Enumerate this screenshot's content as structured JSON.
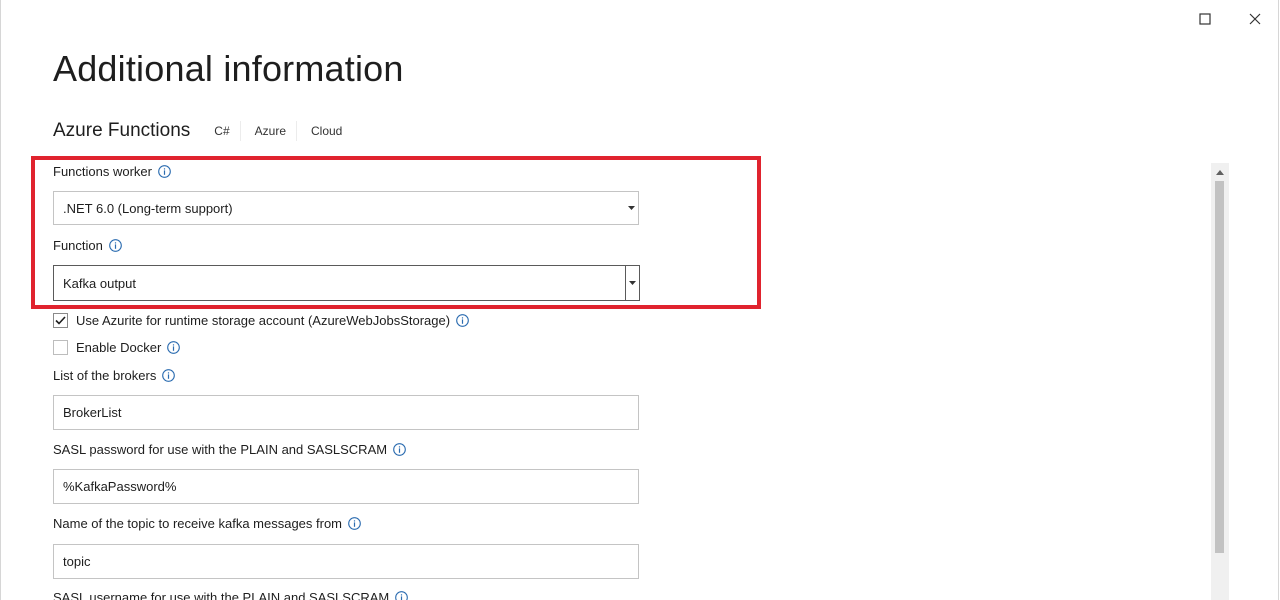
{
  "window": {
    "maximize_icon": "maximize-icon",
    "close_icon": "close-icon"
  },
  "header": {
    "title": "Additional information",
    "subtitle": "Azure Functions",
    "tags": [
      "C#",
      "Azure",
      "Cloud"
    ]
  },
  "form": {
    "functions_worker": {
      "label": "Functions worker",
      "value": ".NET 6.0 (Long-term support)"
    },
    "function": {
      "label": "Function",
      "value": "Kafka output"
    },
    "use_azurite": {
      "label": "Use Azurite for runtime storage account (AzureWebJobsStorage)",
      "checked": true
    },
    "enable_docker": {
      "label": "Enable Docker",
      "checked": false
    },
    "brokers": {
      "label": "List of the brokers",
      "value": "BrokerList"
    },
    "sasl_password": {
      "label": "SASL password for use with the PLAIN and SASLSCRAM",
      "value": "%KafkaPassword%"
    },
    "topic": {
      "label": "Name of the topic to receive kafka messages from",
      "value": "topic"
    },
    "sasl_username": {
      "label": "SASL username for use with the PLAIN and SASLSCRAM"
    }
  },
  "colors": {
    "highlight": "#e0232e",
    "info_icon": "#2b6cb0"
  }
}
